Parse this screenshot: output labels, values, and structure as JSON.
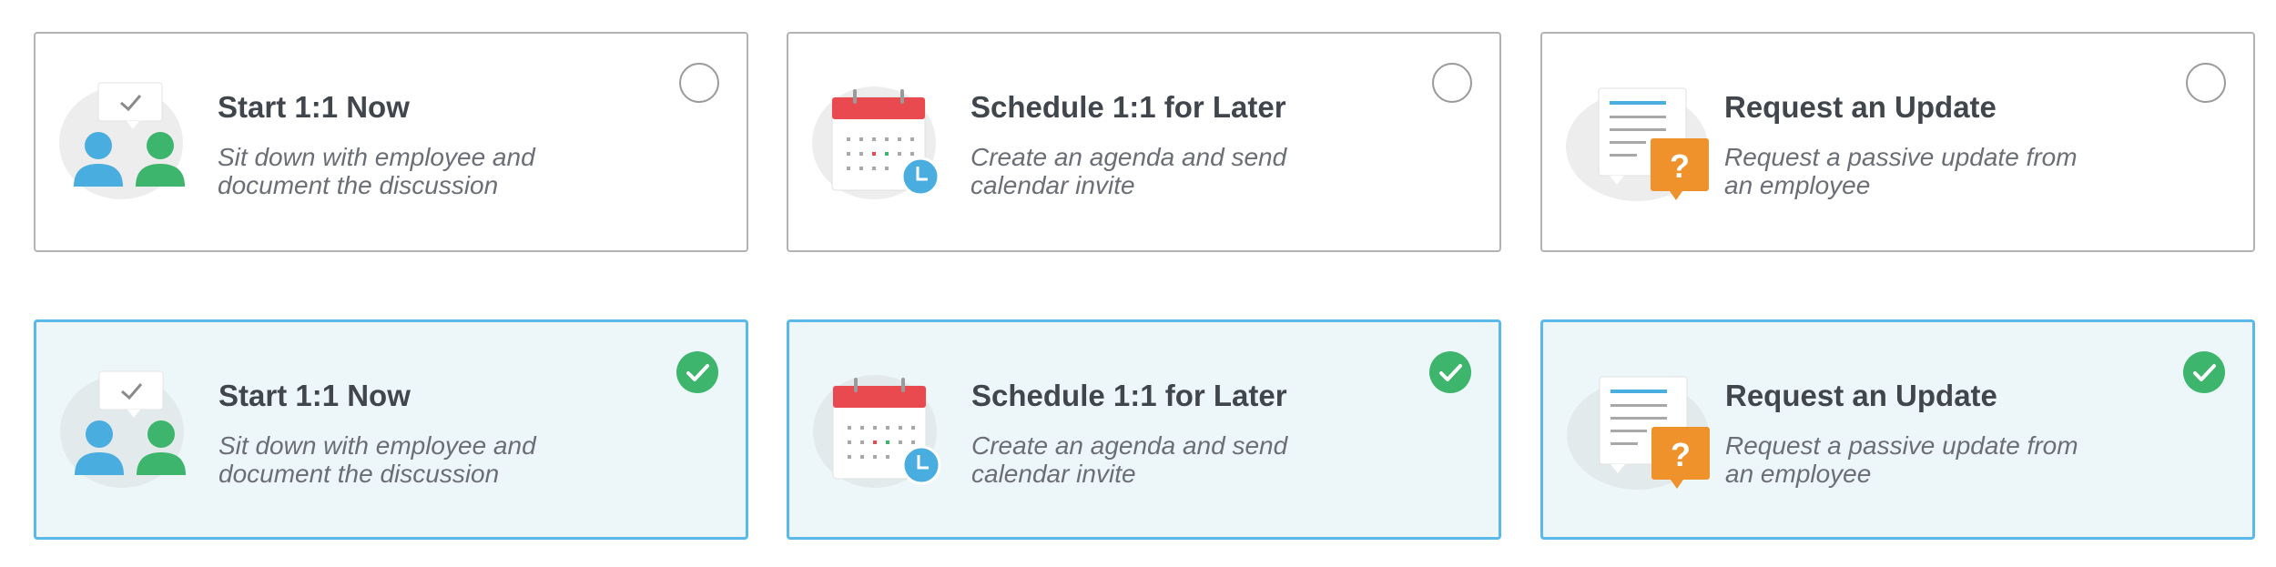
{
  "options": [
    {
      "title": "Start 1:1 Now",
      "desc_line1": "Sit down with employee and",
      "desc_line2": "document the discussion",
      "icon": "meeting-people-icon"
    },
    {
      "title": "Schedule 1:1 for Later",
      "desc_line1": "Create an agenda and send",
      "desc_line2": "calendar invite",
      "icon": "calendar-clock-icon"
    },
    {
      "title": "Request an Update",
      "desc_line1": "Request a passive update from",
      "desc_line2": "an employee",
      "icon": "document-question-icon"
    }
  ],
  "states": {
    "row1": "unselected",
    "row2": "selected"
  },
  "colors": {
    "selected_border": "#5ab9e8",
    "selected_bg": "#edf7fa",
    "check_green": "#3db56c",
    "title_text": "#41464d",
    "desc_text": "#6b6f75",
    "person_blue": "#4aade0",
    "person_green": "#3db56c",
    "calendar_red": "#e84a4f",
    "bubble_orange": "#f0922b"
  }
}
